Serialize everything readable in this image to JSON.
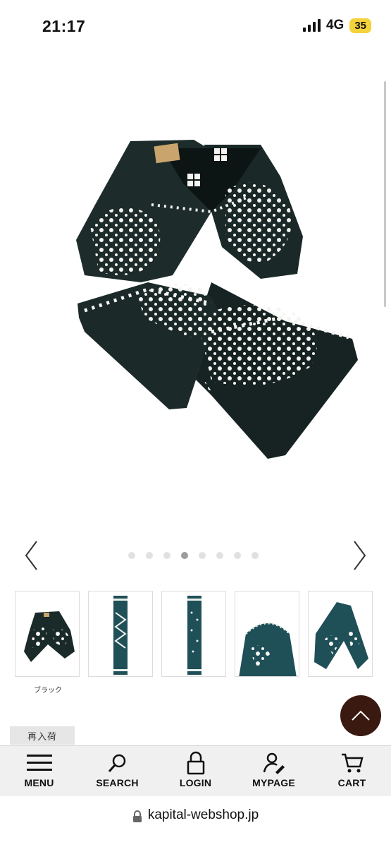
{
  "status_bar": {
    "time": "21:17",
    "network": "4G",
    "battery": "35"
  },
  "carousel": {
    "dot_count": 8,
    "active_index": 3
  },
  "thumbnails": [
    {
      "label": "ブラック"
    },
    {
      "label": ""
    },
    {
      "label": ""
    },
    {
      "label": ""
    },
    {
      "label": ""
    }
  ],
  "restock_label": "再入荷",
  "nav": {
    "menu": "MENU",
    "search": "SEARCH",
    "login": "LOGIN",
    "mypage": "MYPAGE",
    "cart": "CART"
  },
  "url_bar": {
    "url": "kapital-webshop.jp"
  },
  "colors": {
    "scarf_black": "#1a2a28",
    "scarf_teal": "#1f4f57",
    "back_to_top": "#3a1a10",
    "battery": "#f3d23b"
  }
}
